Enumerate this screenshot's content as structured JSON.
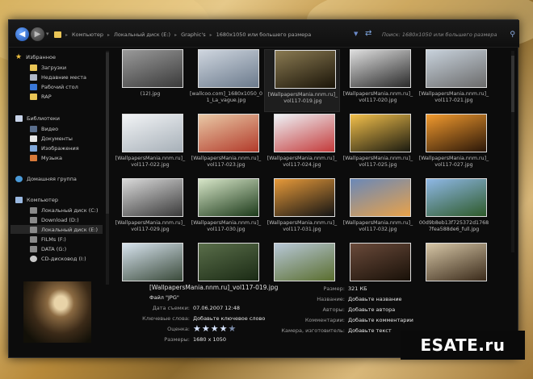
{
  "toolbar": {
    "path": [
      "Компьютер",
      "Локальный диск (E:)",
      "Graphic's",
      "1680x1050 или большего размера"
    ],
    "search_placeholder": "Поиск: 1680x1050 или большего размера"
  },
  "sidebar": {
    "favorites": "Избранное",
    "favorites_items": [
      "Загрузки",
      "Недавние места",
      "Рабочий стол",
      "RAP"
    ],
    "libraries": "Библиотеки",
    "libraries_items": [
      "Видео",
      "Документы",
      "Изображения",
      "Музыка"
    ],
    "homegroup": "Домашняя группа",
    "computer": "Компьютер",
    "computer_items": [
      "Локальный диск (C:)",
      "Download (D:)",
      "Локальный диск (E:)",
      "FILMs (F:)",
      "DATA (G:)",
      "CD-дисковод (I:)"
    ]
  },
  "files": [
    {
      "name": "(12).jpg",
      "c1": "#9a9a9a",
      "c2": "#3a3a3a"
    },
    {
      "name": "[wallcoo.com]_1680x1050_01_La_vague.jpg",
      "c1": "#cfd6df",
      "c2": "#6b7a8c"
    },
    {
      "name": "[WallpapersMania.nnm.ru]_vol117-019.jpg",
      "c1": "#8a7a52",
      "c2": "#1a1408"
    },
    {
      "name": "[WallpapersMania.nnm.ru]_vol117-020.jpg",
      "c1": "#dedede",
      "c2": "#2a2a2a"
    },
    {
      "name": "[WallpapersMania.nnm.ru]_vol117-021.jpg",
      "c1": "#c8d2dc",
      "c2": "#6b6b6b"
    },
    {
      "name": "[WallpapersMania.nnm.ru]_vol117-022.jpg",
      "c1": "#f2f4f6",
      "c2": "#a7b0b8"
    },
    {
      "name": "[WallpapersMania.nnm.ru]_vol117-023.jpg",
      "c1": "#e9c9a6",
      "c2": "#b23a2a"
    },
    {
      "name": "[WallpapersMania.nnm.ru]_vol117-024.jpg",
      "c1": "#eef3f7",
      "c2": "#c43a3a"
    },
    {
      "name": "[WallpapersMania.nnm.ru]_vol117-025.jpg",
      "c1": "#f3c04b",
      "c2": "#1a1a10"
    },
    {
      "name": "[WallpapersMania.nnm.ru]_vol117-027.jpg",
      "c1": "#f29a2e",
      "c2": "#2a1608"
    },
    {
      "name": "[WallpapersMania.nnm.ru]_vol117-029.jpg",
      "c1": "#d9d9d9",
      "c2": "#3a3a3a"
    },
    {
      "name": "[WallpapersMania.nnm.ru]_vol117-030.jpg",
      "c1": "#d7e6c8",
      "c2": "#1c3a1a"
    },
    {
      "name": "[WallpapersMania.nnm.ru]_vol117-031.jpg",
      "c1": "#e79a3a",
      "c2": "#141414"
    },
    {
      "name": "[WallpapersMania.nnm.ru]_vol117-032.jpg",
      "c1": "#6a88b8",
      "c2": "#e8a24a"
    },
    {
      "name": "00d9b8eb13f725372d17687fea588de6_full.jpg",
      "c1": "#8fb8e6",
      "c2": "#2e5a2a"
    },
    {
      "name": "",
      "c1": "#d7e3ee",
      "c2": "#3a4a3a"
    },
    {
      "name": "",
      "c1": "#5a6e4a",
      "c2": "#1a2a14"
    },
    {
      "name": "",
      "c1": "#b8c8d8",
      "c2": "#5a6e2e"
    },
    {
      "name": "",
      "c1": "#6a4a3a",
      "c2": "#181008"
    },
    {
      "name": "",
      "c1": "#d6c6a6",
      "c2": "#3a2a1a"
    }
  ],
  "details": {
    "title": "[WallpapersMania.nnm.ru]_vol117-019.jpg",
    "type_label": "Файл \"JPG\"",
    "date_label": "Дата съемки:",
    "date_value": "07.06.2007 12:48",
    "keywords_label": "Ключевые слова:",
    "keywords_value": "Добавьте ключевое слово",
    "rating_label": "Оценка:",
    "rating_value": 4,
    "rating_max": 5,
    "dims_label": "Размеры:",
    "dims_value": "1680 x 1050",
    "size_label": "Размер:",
    "size_value": "321 КБ",
    "name_label": "Название:",
    "name_value": "Добавьте название",
    "authors_label": "Авторы:",
    "authors_value": "Добавьте автора",
    "comments_label": "Комментарии:",
    "comments_value": "Добавьте комментарии",
    "camera_label": "Камера, изготовитель:",
    "camera_value": "Добавьте текст"
  },
  "brand": "ESATE.ru",
  "colors": {
    "accent": "#3a78d8",
    "window_bg": "#0c0c0c",
    "folder": "#e9c556"
  }
}
